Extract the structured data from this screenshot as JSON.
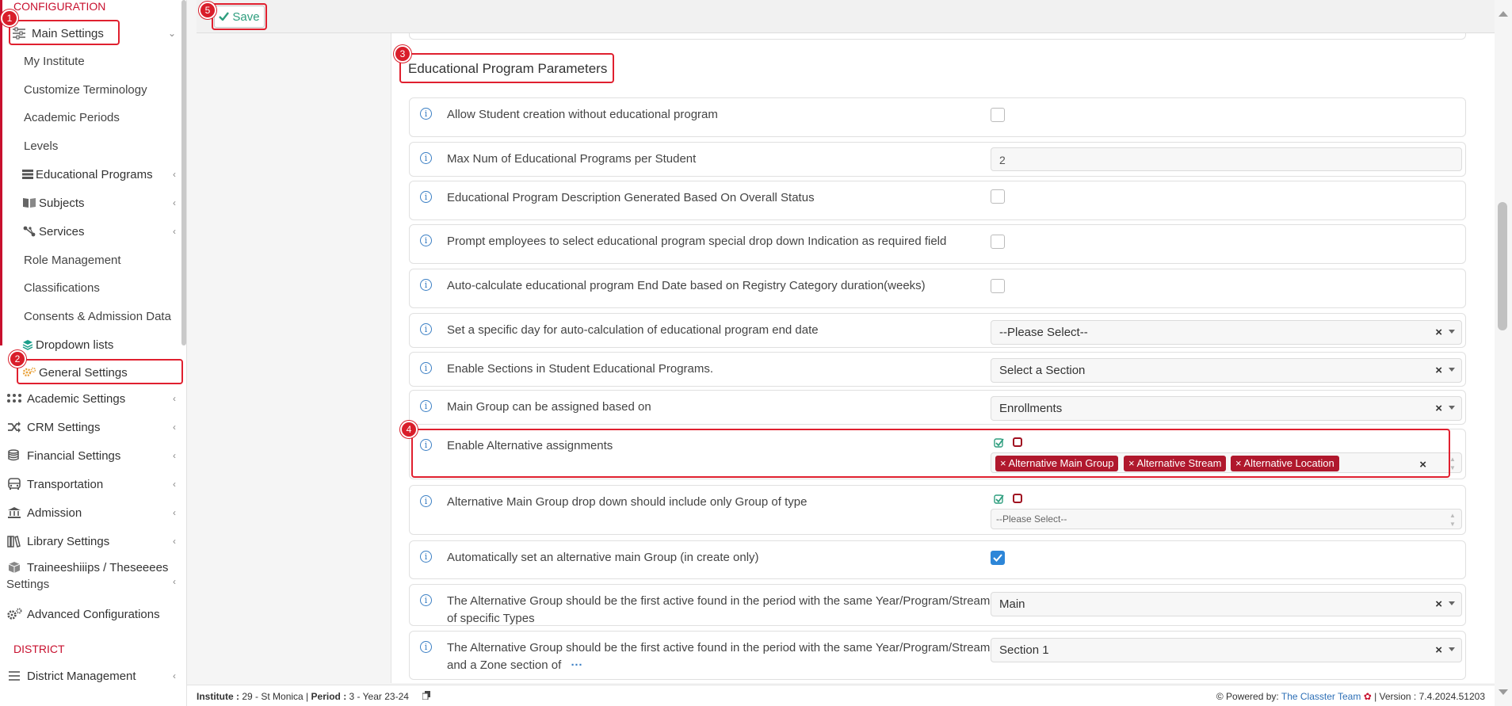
{
  "sidebar": {
    "section_configuration": "CONFIGURATION",
    "main_settings": "Main Settings",
    "sub_items": [
      "My Institute",
      "Customize Terminology",
      "Academic Periods",
      "Levels"
    ],
    "educational_programs": "Educational Programs",
    "subjects": "Subjects",
    "services": "Services",
    "sub_items2": [
      "Role Management",
      "Classifications",
      "Consents & Admission Data"
    ],
    "dropdown_lists": "Dropdown lists",
    "general_settings": "General Settings",
    "academic_settings": "Academic Settings",
    "crm_settings": "CRM Settings",
    "financial_settings": "Financial Settings",
    "transportation": "Transportation",
    "admission": "Admission",
    "library_settings": "Library Settings",
    "traineeships_line1": "Traineeshiiips / Theseeees",
    "traineeships_line2": "Settings",
    "advanced_configurations": "Advanced Configurations",
    "section_district": "DISTRICT",
    "district_management": "District Management"
  },
  "toolbar": {
    "save_label": "Save"
  },
  "main": {
    "section_title": "Educational Program Parameters",
    "rows": {
      "allow_student": "Allow Student creation without educational program",
      "max_num": "Max Num of Educational Programs per Student",
      "max_num_value": "2",
      "description_generated": "Educational Program Description Generated Based On Overall Status",
      "prompt_employees": "Prompt employees to select educational program special drop down Indication as required field",
      "auto_calc_end": "Auto-calculate educational program End Date based on Registry Category duration(weeks)",
      "specific_day": "Set a specific day for auto-calculation of educational program end date",
      "specific_day_value": "--Please Select--",
      "enable_sections": "Enable Sections in Student Educational Programs.",
      "enable_sections_value": "Select a Section",
      "main_group_assigned": "Main Group can be assigned based on",
      "main_group_assigned_value": "Enrollments",
      "enable_alternative": "Enable Alternative assignments",
      "alternative_tags": [
        "Alternative Main Group",
        "Alternative Stream",
        "Alternative Location"
      ],
      "alt_main_group_dropdown": "Alternative Main Group drop down should include only Group of type",
      "alt_main_group_dropdown_value": "--Please Select--",
      "auto_set_alt": "Automatically set an alternative main Group (in create only)",
      "alt_group_first_types": "The Alternative Group should be the first active found in the period with the same Year/Program/Stream of specific Types",
      "alt_group_first_types_value": "Main",
      "alt_group_zone_line1": "The Alternative Group should be the first active found in the period with the same Year/Program/Stream",
      "alt_group_zone_line2": "and a Zone section of",
      "alt_group_zone_value": "Section 1"
    }
  },
  "footer": {
    "institute_label": "Institute :",
    "institute_value": "29 - St Monica",
    "period_label": "Period :",
    "period_value": "3 - Year 23-24",
    "powered_by": "Powered by:",
    "team": "The Classter Team",
    "version": "| Version : 7.4.2024.51203"
  },
  "annotations": [
    "1",
    "2",
    "3",
    "4",
    "5"
  ],
  "colors": {
    "accent_red": "#c8102e",
    "annotation_red": "#e0202f",
    "tag_red": "#b0182d",
    "save_green": "#2e9e7e",
    "check_blue": "#2d86d8"
  }
}
